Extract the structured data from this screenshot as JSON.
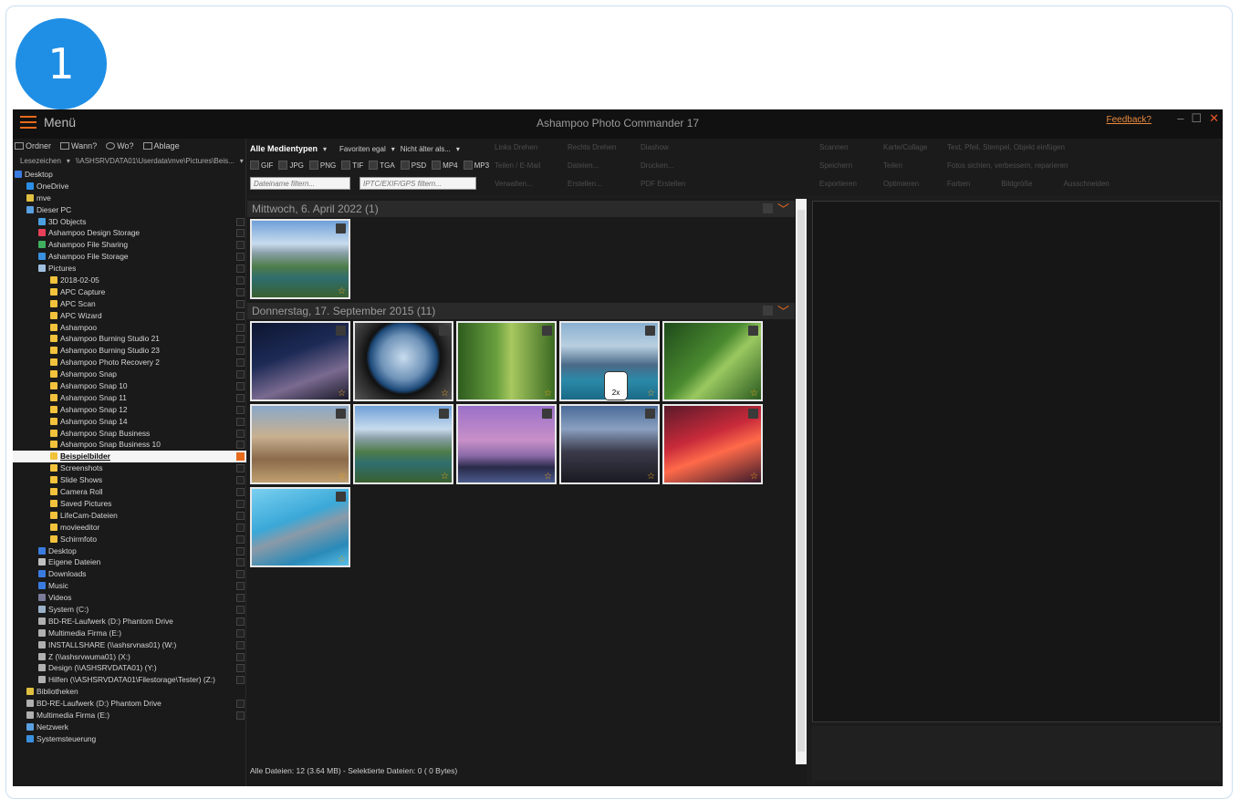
{
  "step_number": "1",
  "app": {
    "menu_label": "Menü",
    "title": "Ashampoo Photo Commander 17",
    "feedback": "Feedback?",
    "window_controls": [
      "–",
      "☐",
      "✕"
    ]
  },
  "nav_tabs": [
    "Ordner",
    "Wann?",
    "Wo?",
    "Ablage"
  ],
  "bookmark": {
    "label": "Lesezeichen",
    "path": "\\\\ASHSRVDATA01\\Userdata\\mve\\Pictures\\Beis..."
  },
  "tree": [
    {
      "label": "Desktop",
      "level": 0,
      "icon": "#3a7be0"
    },
    {
      "label": "OneDrive",
      "level": 1,
      "icon": "#2b8ee6"
    },
    {
      "label": "mve",
      "level": 1,
      "icon": "#e0c040"
    },
    {
      "label": "Dieser PC",
      "level": 1,
      "icon": "#5aa0e0"
    },
    {
      "label": "3D Objects",
      "level": 2,
      "icon": "#4aa0e0"
    },
    {
      "label": "Ashampoo Design Storage",
      "level": 2,
      "icon": "#e8405a"
    },
    {
      "label": "Ashampoo File Sharing",
      "level": 2,
      "icon": "#40b060"
    },
    {
      "label": "Ashampoo File Storage",
      "level": 2,
      "icon": "#3a90e0"
    },
    {
      "label": "Pictures",
      "level": 2,
      "icon": "#a0c0e0"
    },
    {
      "label": "2018-02-05",
      "level": 3,
      "icon": "#f2c23c"
    },
    {
      "label": "APC Capture",
      "level": 3,
      "icon": "#f2c23c"
    },
    {
      "label": "APC Scan",
      "level": 3,
      "icon": "#f2c23c"
    },
    {
      "label": "APC Wizard",
      "level": 3,
      "icon": "#f2c23c"
    },
    {
      "label": "Ashampoo",
      "level": 3,
      "icon": "#f2c23c"
    },
    {
      "label": "Ashampoo Burning Studio 21",
      "level": 3,
      "icon": "#f2c23c"
    },
    {
      "label": "Ashampoo Burning Studio 23",
      "level": 3,
      "icon": "#f2c23c"
    },
    {
      "label": "Ashampoo Photo Recovery 2",
      "level": 3,
      "icon": "#f2c23c"
    },
    {
      "label": "Ashampoo Snap",
      "level": 3,
      "icon": "#f2c23c"
    },
    {
      "label": "Ashampoo Snap 10",
      "level": 3,
      "icon": "#f2c23c"
    },
    {
      "label": "Ashampoo Snap 11",
      "level": 3,
      "icon": "#f2c23c"
    },
    {
      "label": "Ashampoo Snap 12",
      "level": 3,
      "icon": "#f2c23c"
    },
    {
      "label": "Ashampoo Snap 14",
      "level": 3,
      "icon": "#f2c23c"
    },
    {
      "label": "Ashampoo Snap Business",
      "level": 3,
      "icon": "#f2c23c"
    },
    {
      "label": "Ashampoo Snap Business 10",
      "level": 3,
      "icon": "#f2c23c"
    },
    {
      "label": "Beispielbilder",
      "level": 3,
      "icon": "#f2c23c",
      "selected": true
    },
    {
      "label": "Screenshots",
      "level": 3,
      "icon": "#f2c23c"
    },
    {
      "label": "Slide Shows",
      "level": 3,
      "icon": "#f2c23c"
    },
    {
      "label": "Camera Roll",
      "level": 3,
      "icon": "#f2c23c"
    },
    {
      "label": "Saved Pictures",
      "level": 3,
      "icon": "#f2c23c"
    },
    {
      "label": "LifeCam-Dateien",
      "level": 3,
      "icon": "#f2c23c"
    },
    {
      "label": "movieeditor",
      "level": 3,
      "icon": "#f2c23c"
    },
    {
      "label": "Schirmfoto",
      "level": 3,
      "icon": "#f2c23c"
    },
    {
      "label": "Desktop",
      "level": 2,
      "icon": "#3a7be0"
    },
    {
      "label": "Eigene Dateien",
      "level": 2,
      "icon": "#c0c0c0"
    },
    {
      "label": "Downloads",
      "level": 2,
      "icon": "#3a7be0"
    },
    {
      "label": "Music",
      "level": 2,
      "icon": "#3a7be0"
    },
    {
      "label": "Videos",
      "level": 2,
      "icon": "#7a7a9a"
    },
    {
      "label": "System (C:)",
      "level": 2,
      "icon": "#9ab0c8"
    },
    {
      "label": "BD-RE-Laufwerk (D:) Phantom Drive",
      "level": 2,
      "icon": "#b0b0b0"
    },
    {
      "label": "Multimedia Firma (E:)",
      "level": 2,
      "icon": "#b0b0b0"
    },
    {
      "label": "INSTALLSHARE (\\\\ashsrvnas01) (W:)",
      "level": 2,
      "icon": "#b0b0b0"
    },
    {
      "label": "Z (\\\\ashsrvwuma01) (X:)",
      "level": 2,
      "icon": "#b0b0b0"
    },
    {
      "label": "Design (\\\\ASHSRVDATA01) (Y:)",
      "level": 2,
      "icon": "#b0b0b0"
    },
    {
      "label": "Hilfen (\\\\ASHSRVDATA01\\Filestorage\\Tester) (Z:)",
      "level": 2,
      "icon": "#b0b0b0"
    },
    {
      "label": "Bibliotheken",
      "level": 1,
      "icon": "#e0c040"
    },
    {
      "label": "BD-RE-Laufwerk (D:) Phantom Drive",
      "level": 1,
      "icon": "#b0b0b0"
    },
    {
      "label": "Multimedia Firma (E:)",
      "level": 1,
      "icon": "#b0b0b0"
    },
    {
      "label": "Netzwerk",
      "level": 1,
      "icon": "#5aa0e0"
    },
    {
      "label": "Systemsteuerung",
      "level": 1,
      "icon": "#3a90e0"
    }
  ],
  "toolbar": {
    "media_type": "Alle Medientypen",
    "favorites": "Favoriten egal",
    "age": "Nicht älter als...",
    "type_filters": [
      "GIF",
      "JPG",
      "PNG",
      "TIF",
      "TGA",
      "PSD",
      "MP4",
      "MP3"
    ],
    "filename_placeholder": "Dateiname filtern...",
    "meta_placeholder": "IPTC/EXIF/GPS filtern...",
    "group1": [
      "Links Drehen",
      "Teilen / E-Mail",
      "Verwalten..."
    ],
    "group2": [
      "Rechts Drehen",
      "Dateien...",
      "Erstellen..."
    ],
    "group3": [
      "Diashow",
      "Drucken...",
      "PDF Erstellen"
    ],
    "group4": [
      "Scannen",
      "Speichern",
      "Exportieren"
    ],
    "group5": [
      "Karte/Collage",
      "Teilen",
      "Optimieren"
    ],
    "group6": [
      "Text, Pfeil, Stempel, Objekt einfügen",
      "Fotos sichten, verbessern, reparieren"
    ],
    "group7": [
      "Farben",
      "Bildgröße",
      "Ausschneiden"
    ]
  },
  "groups": [
    {
      "date": "Mittwoch, 6. April 2022 (1)"
    },
    {
      "date": "Donnerstag, 17. September 2015 (11)"
    }
  ],
  "mouse_hint": "2x",
  "status": "Alle Dateien: 12 (3.64 MB) - Selektierte Dateien: 0 (  0 Bytes)",
  "colors": {
    "accent": "#e86a1b",
    "badge": "#1f8fe6"
  }
}
